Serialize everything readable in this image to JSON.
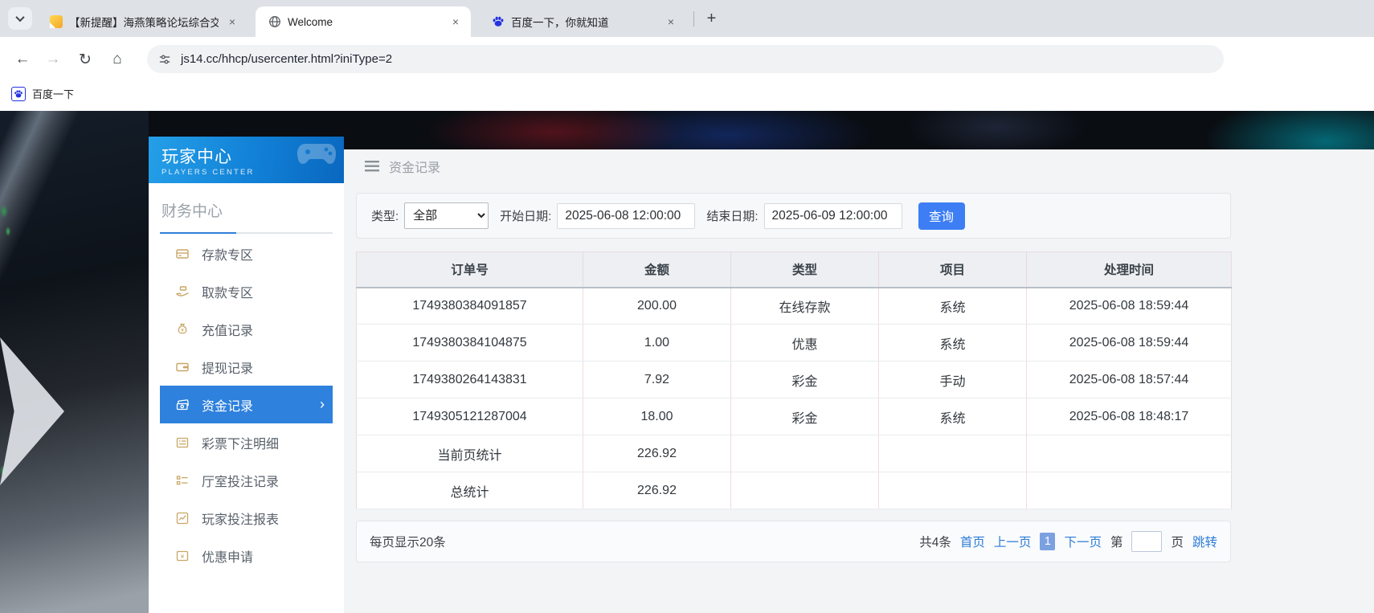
{
  "browser": {
    "tabs": [
      {
        "title": "【新提醒】海燕策略论坛综合交"
      },
      {
        "title": "Welcome"
      },
      {
        "title": "百度一下，你就知道"
      }
    ],
    "icons": {
      "close": "×",
      "new_tab": "+",
      "back": "←",
      "forward": "→",
      "reload": "↻",
      "home": "⌂"
    },
    "url": "js14.cc/hhcp/usercenter.html?iniType=2",
    "bookmarks": [
      {
        "label": "百度一下"
      }
    ]
  },
  "sidebar": {
    "title": "玩家中心",
    "subtitle": "PLAYERS CENTER",
    "section": "财务中心",
    "active_arrow": "›",
    "items": [
      {
        "label": "存款专区"
      },
      {
        "label": "取款专区"
      },
      {
        "label": "充值记录"
      },
      {
        "label": "提现记录"
      },
      {
        "label": "资金记录",
        "active": true
      },
      {
        "label": "彩票下注明细"
      },
      {
        "label": "厅室投注记录"
      },
      {
        "label": "玩家投注报表"
      },
      {
        "label": "优惠申请"
      }
    ]
  },
  "main": {
    "title": "资金记录",
    "filter": {
      "type_label": "类型:",
      "type_value": "全部",
      "start_label": "开始日期:",
      "start_value": "2025-06-08 12:00:00",
      "end_label": "结束日期:",
      "end_value": "2025-06-09 12:00:00",
      "query_label": "查询"
    },
    "table": {
      "headers": [
        "订单号",
        "金额",
        "类型",
        "项目",
        "处理时间"
      ],
      "rows": [
        [
          "1749380384091857",
          "200.00",
          "在线存款",
          "系统",
          "2025-06-08 18:59:44"
        ],
        [
          "1749380384104875",
          "1.00",
          "优惠",
          "系统",
          "2025-06-08 18:59:44"
        ],
        [
          "1749380264143831",
          "7.92",
          "彩金",
          "手动",
          "2025-06-08 18:57:44"
        ],
        [
          "1749305121287004",
          "18.00",
          "彩金",
          "系统",
          "2025-06-08 18:48:17"
        ],
        [
          "当前页统计",
          "226.92",
          "",
          "",
          ""
        ],
        [
          "总统计",
          "226.92",
          "",
          "",
          ""
        ]
      ]
    },
    "pagination": {
      "per_page": "每页显示20条",
      "total": "共4条",
      "first": "首页",
      "prev": "上一页",
      "current": "1",
      "next": "下一页",
      "page_prefix": "第",
      "page_suffix": "页",
      "jump": "跳转"
    }
  },
  "colors": {
    "sidebar_active": "#2e81dc",
    "query_button": "#3d7ef5",
    "link_blue": "#2d7cd8",
    "menu_icon_gold": "#c9a665",
    "baidu_blue": "#2532e1",
    "header_gradient_start": "#259fe8",
    "header_gradient_end": "#0a67bf"
  }
}
